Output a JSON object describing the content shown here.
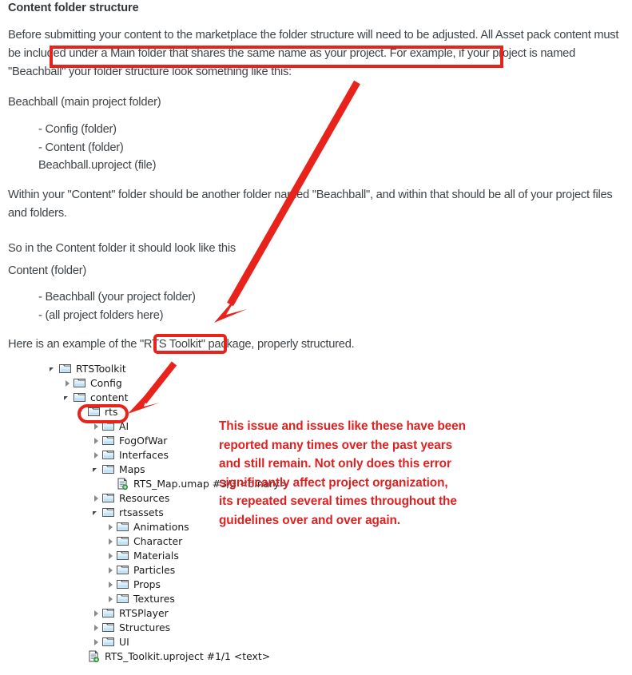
{
  "document": {
    "title": "Content folder structure",
    "paragraphs": {
      "p1": "Before submitting your content to the marketplace the folder structure will need to be adjusted. All Asset pack content must be included under a Main folder that shares the same name as your project. For example, if your project is named \"Beachball\" your folder structure look something like this:",
      "p2": "Beachball (main project folder)",
      "p3": "Within your \"Content\" folder should be another folder named \"Beachball\", and within that should be all of your project files and folders.",
      "p4": "So in the Content folder it should look like this",
      "p5": "Content (folder)",
      "p6": "Here is an example of the \"RTS Toolkit\" package, properly structured."
    },
    "list1": [
      "- Config (folder)",
      "- Content (folder)",
      "Beachball.uproject (file)"
    ],
    "list2": [
      "- Beachball (your project folder)",
      "- (all project folders here)"
    ]
  },
  "tree": {
    "nodes": [
      {
        "label": "RTSToolkit",
        "depth": 0,
        "icon": "folder-icon",
        "twisty": "expanded"
      },
      {
        "label": "Config",
        "depth": 1,
        "icon": "folder-icon",
        "twisty": "collapsed"
      },
      {
        "label": "content",
        "depth": 1,
        "icon": "folder-icon",
        "twisty": "expanded"
      },
      {
        "label": "rts",
        "depth": 2,
        "icon": "folder-icon",
        "twisty": "expanded"
      },
      {
        "label": "AI",
        "depth": 3,
        "icon": "folder-icon",
        "twisty": "collapsed"
      },
      {
        "label": "FogOfWar",
        "depth": 3,
        "icon": "folder-icon",
        "twisty": "collapsed"
      },
      {
        "label": "Interfaces",
        "depth": 3,
        "icon": "folder-icon",
        "twisty": "collapsed"
      },
      {
        "label": "Maps",
        "depth": 3,
        "icon": "folder-icon",
        "twisty": "expanded"
      },
      {
        "label": "RTS_Map.umap #3/3 <binary>",
        "depth": 4,
        "icon": "file-icon",
        "twisty": "none"
      },
      {
        "label": "Resources",
        "depth": 3,
        "icon": "folder-icon",
        "twisty": "collapsed"
      },
      {
        "label": "rtsassets",
        "depth": 3,
        "icon": "folder-icon",
        "twisty": "expanded"
      },
      {
        "label": "Animations",
        "depth": 4,
        "icon": "folder-icon",
        "twisty": "collapsed"
      },
      {
        "label": "Character",
        "depth": 4,
        "icon": "folder-icon",
        "twisty": "collapsed"
      },
      {
        "label": "Materials",
        "depth": 4,
        "icon": "folder-icon",
        "twisty": "collapsed"
      },
      {
        "label": "Particles",
        "depth": 4,
        "icon": "folder-icon",
        "twisty": "collapsed"
      },
      {
        "label": "Props",
        "depth": 4,
        "icon": "folder-icon",
        "twisty": "collapsed"
      },
      {
        "label": "Textures",
        "depth": 4,
        "icon": "folder-icon",
        "twisty": "collapsed"
      },
      {
        "label": "RTSPlayer",
        "depth": 3,
        "icon": "folder-icon",
        "twisty": "collapsed"
      },
      {
        "label": "Structures",
        "depth": 3,
        "icon": "folder-icon",
        "twisty": "collapsed"
      },
      {
        "label": "UI",
        "depth": 3,
        "icon": "folder-icon",
        "twisty": "collapsed"
      },
      {
        "label": "RTS_Toolkit.uproject #1/1 <text>",
        "depth": 2,
        "icon": "file-icon",
        "twisty": "none"
      }
    ]
  },
  "annotations": {
    "color": "#dd2222",
    "box_color": "#e8231c",
    "highlight_main_sentence": "must be included under a Main folder that shares the same name as your project.",
    "highlight_package_name": "RTS Toolkit",
    "highlight_tree_node": "rts",
    "note_lines": [
      "This issue and issues like these have been",
      "reported many times over the past years",
      "and still remain. Not only does this error",
      "significantly affect project organization,",
      "its repeated several times throughout the",
      "guidelines over and over again."
    ]
  }
}
